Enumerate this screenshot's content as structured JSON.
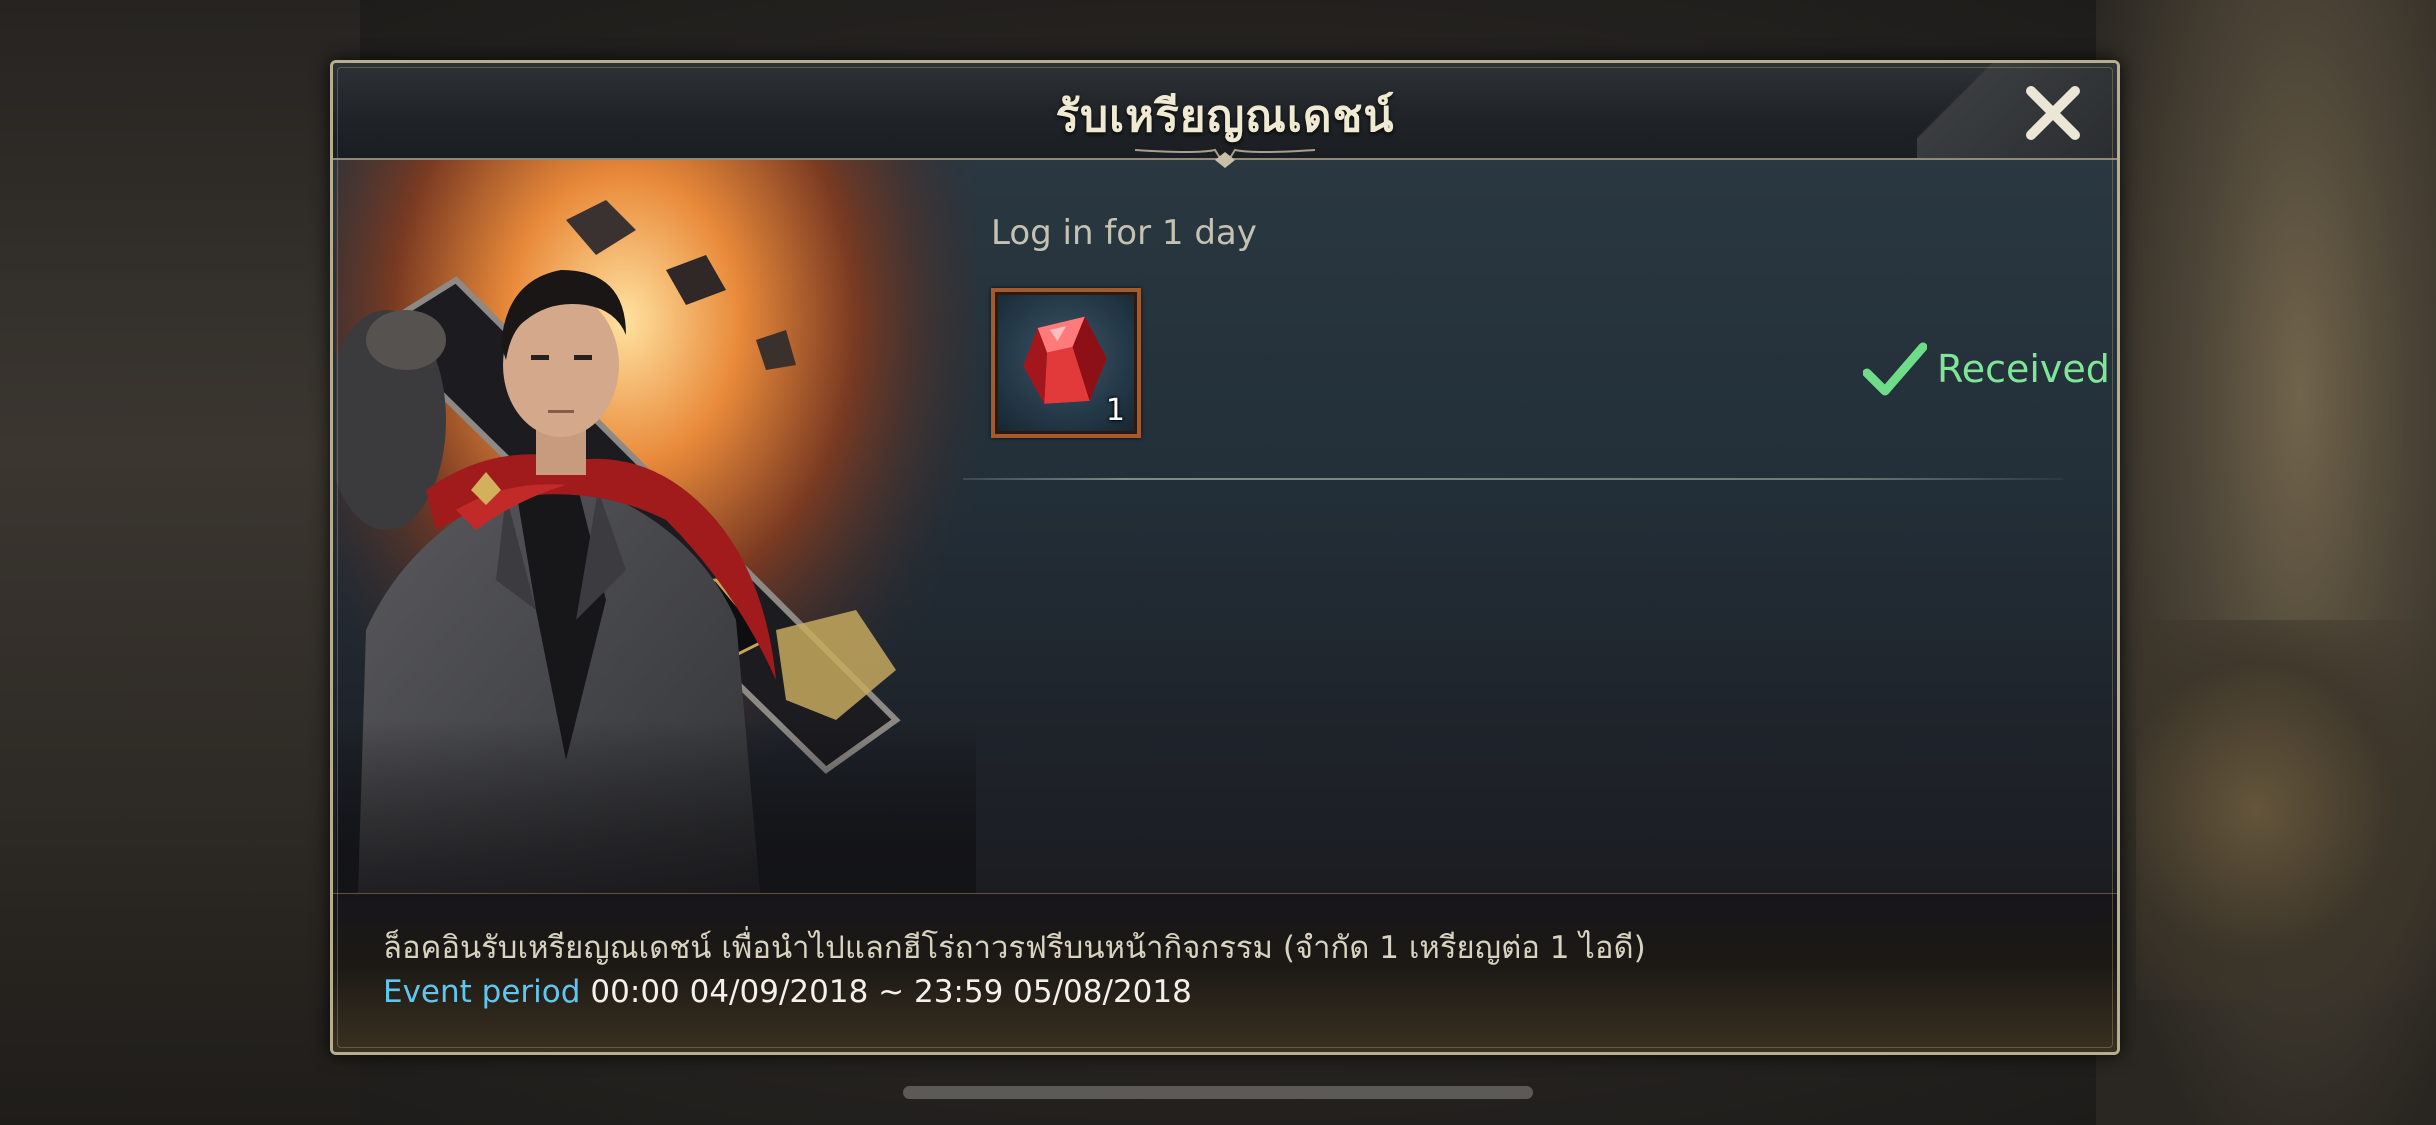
{
  "dialog": {
    "title": "รับเหรียญณเดชน์",
    "close_icon": "close-icon"
  },
  "task": {
    "label": "Log in for 1 day",
    "reward": {
      "icon": "red-gem-icon",
      "count": "1"
    },
    "status": {
      "icon": "checkmark-icon",
      "label": "Received",
      "color": "#7fe597"
    }
  },
  "footer": {
    "description": "ล็อคอินรับเหรียญณเดชน์ เพื่อนำไปแลกฮีโร่ถาวรฟรีบนหน้ากิจกรรม (จำกัด 1 เหรียญต่อ 1 ไอดี)",
    "period_label": "Event period",
    "period_value": "00:00 04/09/2018 ~ 23:59 05/08/2018",
    "period_label_color": "#5fc6ef"
  }
}
